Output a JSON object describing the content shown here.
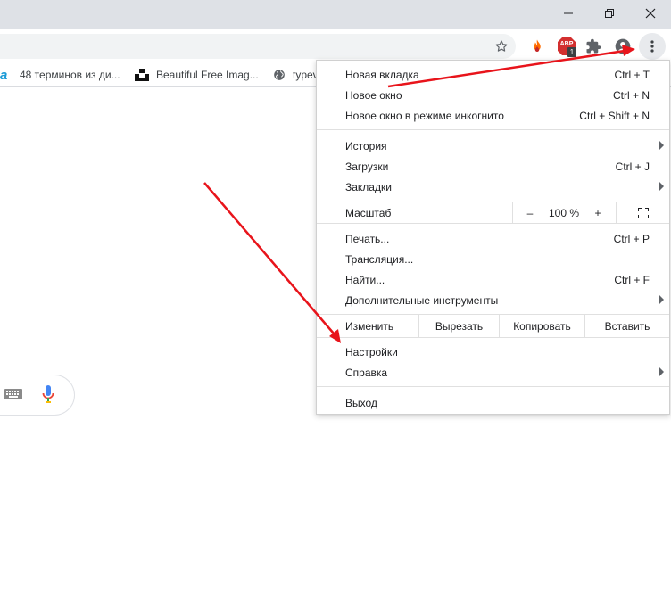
{
  "window": {
    "minimize_icon": "minimize-icon",
    "restore_icon": "restore-icon",
    "close_icon": "close-icon"
  },
  "toolbar": {
    "extensions": [
      "star-icon",
      "flame-extension-icon",
      "adblock-extension-icon",
      "puzzle-extensions-icon",
      "profile-icon",
      "menu-dots-icon"
    ],
    "adblock_text": "ABP",
    "adblock_badge": "1"
  },
  "bookmarks": [
    {
      "label": "a",
      "icon": "bookmark-logo-icon"
    },
    {
      "label": "48 терминов из ди...",
      "icon": "bookmark-icon"
    },
    {
      "label": "Beautiful Free Imag...",
      "icon": "unsplash-icon"
    },
    {
      "label": "typev",
      "icon": "globe-icon"
    }
  ],
  "menu": {
    "new_tab": {
      "label": "Новая вкладка",
      "shortcut": "Ctrl + T"
    },
    "new_window": {
      "label": "Новое окно",
      "shortcut": "Ctrl + N"
    },
    "incognito": {
      "label": "Новое окно в режиме инкогнито",
      "shortcut": "Ctrl + Shift + N"
    },
    "history": {
      "label": "История"
    },
    "downloads": {
      "label": "Загрузки",
      "shortcut": "Ctrl + J"
    },
    "bookmarks": {
      "label": "Закладки"
    },
    "zoom": {
      "label": "Масштаб",
      "minus": "–",
      "value": "100 %",
      "plus": "+"
    },
    "print": {
      "label": "Печать...",
      "shortcut": "Ctrl + P"
    },
    "cast": {
      "label": "Трансляция..."
    },
    "find": {
      "label": "Найти...",
      "shortcut": "Ctrl + F"
    },
    "more_tools": {
      "label": "Дополнительные инструменты"
    },
    "edit": {
      "label": "Изменить",
      "cut": "Вырезать",
      "copy": "Копировать",
      "paste": "Вставить"
    },
    "settings": {
      "label": "Настройки"
    },
    "help": {
      "label": "Справка"
    },
    "exit": {
      "label": "Выход"
    }
  },
  "colors": {
    "annotation_arrow": "#e8141b",
    "mic_blue": "#4285f4",
    "mic_red": "#ea4335"
  }
}
